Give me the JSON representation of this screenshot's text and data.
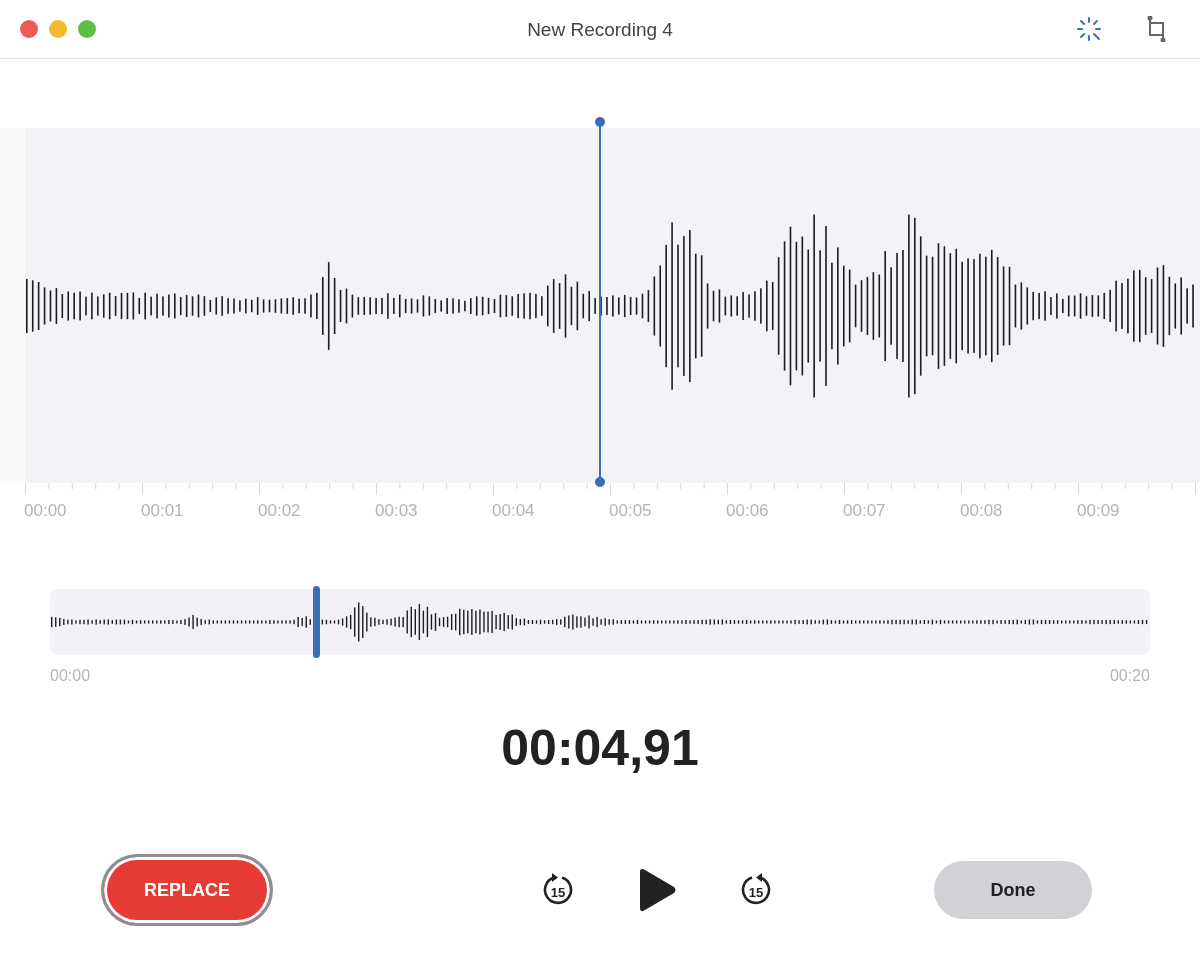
{
  "window": {
    "title": "New Recording 4"
  },
  "waveform": {
    "time_labels": [
      "00:00",
      "00:01",
      "00:02",
      "00:03",
      "00:04",
      "00:05",
      "00:06",
      "00:07",
      "00:08",
      "00:09"
    ]
  },
  "overview": {
    "start_label": "00:00",
    "end_label": "00:20",
    "level": 0.242
  },
  "current_time": "00:04,91",
  "controls": {
    "replace_button": "REPLACE",
    "skip_back": "15",
    "skip_forward": "15",
    "done_button": "Done"
  }
}
